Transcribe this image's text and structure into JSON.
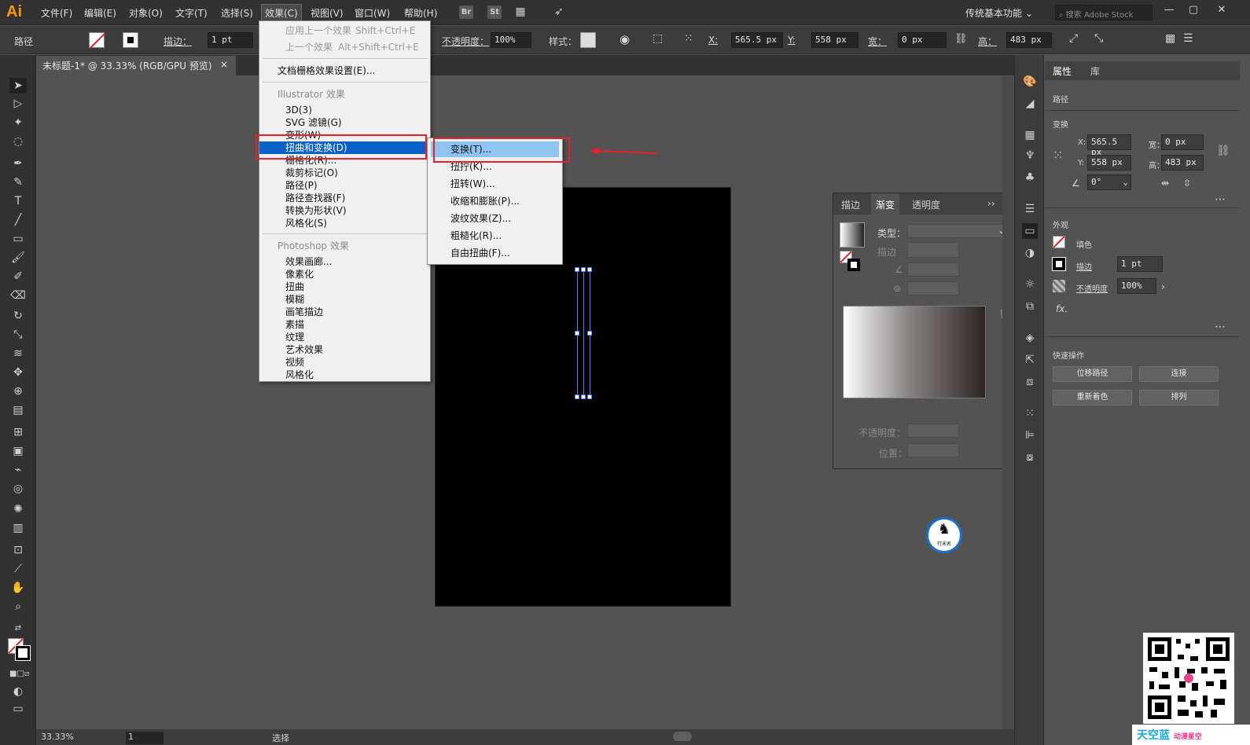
{
  "app": {
    "logo": "Ai",
    "menus": [
      "文件(F)",
      "编辑(E)",
      "对象(O)",
      "文字(T)",
      "选择(S)",
      "效果(C)",
      "视图(V)",
      "窗口(W)",
      "帮助(H)"
    ],
    "active_menu": "效果(C)",
    "bridge_label": "Br",
    "stock_label": "St",
    "workspace": "传统基本功能",
    "stock_search_placeholder": "搜索 Adobe Stock"
  },
  "control_bar": {
    "object_type": "路径",
    "stroke_label": "描边：",
    "stroke_value": "1 pt",
    "opacity_label": "不透明度：",
    "opacity_value": "100%",
    "style_label": "样式：",
    "x_label": "X:",
    "x_value": "565.5 px",
    "y_label": "Y:",
    "y_value": "558 px",
    "w_label": "宽：",
    "w_value": "0 px",
    "h_label": "高：",
    "h_value": "483 px"
  },
  "document": {
    "tab_title": "未标题-1* @ 33.33% (RGB/GPU 预览)",
    "close_glyph": "×"
  },
  "effect_menu": {
    "apply_last": "应用上一个效果",
    "apply_last_shortcut": "Shift+Ctrl+E",
    "last_effect": "上一个效果",
    "last_effect_shortcut": "Alt+Shift+Ctrl+E",
    "raster_settings": "文档栅格效果设置(E)...",
    "illustrator_header": "Illustrator 效果",
    "illustrator_items": [
      "3D(3)",
      "SVG 滤镜(G)",
      "变形(W)",
      "扭曲和变换(D)",
      "栅格化(R)...",
      "裁剪标记(O)",
      "路径(P)",
      "路径查找器(F)",
      "转换为形状(V)",
      "风格化(S)"
    ],
    "photoshop_header": "Photoshop 效果",
    "photoshop_items": [
      "效果画廊...",
      "像素化",
      "扭曲",
      "模糊",
      "画笔描边",
      "素描",
      "纹理",
      "艺术效果",
      "视频",
      "风格化"
    ]
  },
  "submenu": {
    "items": [
      "变换(T)...",
      "扭拧(K)...",
      "扭转(W)...",
      "收缩和膨胀(P)...",
      "波纹效果(Z)...",
      "粗糙化(R)...",
      "自由扭曲(F)..."
    ]
  },
  "gradient_panel": {
    "tabs": [
      "描边",
      "渐变",
      "透明度"
    ],
    "active_tab": "渐变",
    "type_label": "类型：",
    "stroke_label": "描边",
    "opacity_label": "不透明度：",
    "position_label": "位置："
  },
  "properties": {
    "tabs": [
      "属性",
      "库"
    ],
    "object_type": "路径",
    "transform_title": "变换",
    "x_label": "X:",
    "x_value": "565.5 px",
    "y_label": "Y:",
    "y_value": "558 px",
    "w_label": "宽：",
    "w_value": "0 px",
    "h_label": "高：",
    "h_value": "483 px",
    "angle_value": "0°",
    "appearance_title": "外观",
    "fill_label": "填色",
    "stroke_label": "描边",
    "stroke_value": "1 pt",
    "opacity_label": "不透明度",
    "opacity_value": "100%",
    "fx_label": "fx.",
    "quick_actions_title": "快速操作",
    "buttons": [
      "位移路径",
      "连接",
      "重新着色",
      "排列"
    ]
  },
  "status_bar": {
    "zoom": "33.33%",
    "page": "1",
    "tool_status": "选择"
  },
  "watermark": {
    "brand_text": "天空蓝",
    "brand_sub": "动漫星空",
    "logo_text": "行未名"
  },
  "colors": {
    "accent_selected": "#0a62c8",
    "submenu_highlight": "#8fc3f0",
    "annotation_red": "#e8202a",
    "selection_blue": "#4f7bff"
  }
}
